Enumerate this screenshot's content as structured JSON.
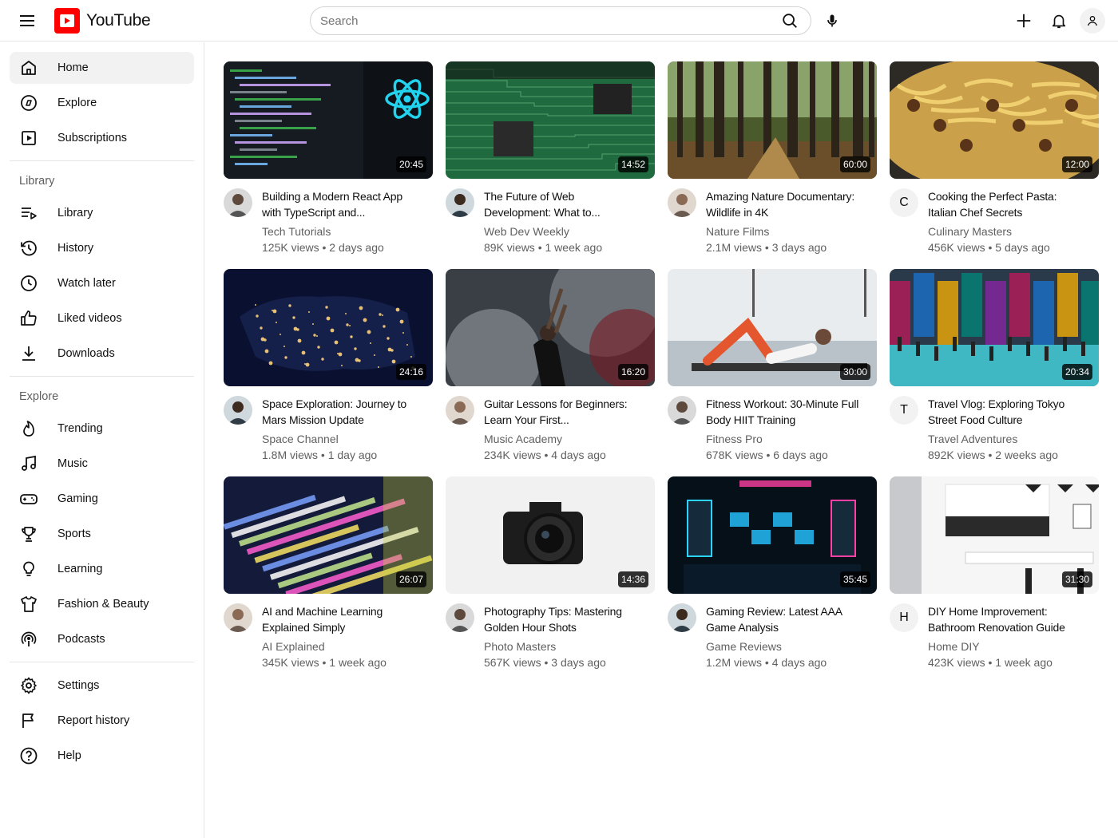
{
  "header": {
    "logo_text": "YouTube",
    "search_placeholder": "Search"
  },
  "sidebar": {
    "main": [
      {
        "label": "Home",
        "icon": "home-icon",
        "active": true
      },
      {
        "label": "Explore",
        "icon": "compass-icon"
      },
      {
        "label": "Subscriptions",
        "icon": "subscriptions-icon"
      }
    ],
    "library_title": "Library",
    "library": [
      {
        "label": "Library",
        "icon": "library-icon"
      },
      {
        "label": "History",
        "icon": "history-icon"
      },
      {
        "label": "Watch later",
        "icon": "clock-icon"
      },
      {
        "label": "Liked videos",
        "icon": "thumbs-up-icon"
      },
      {
        "label": "Downloads",
        "icon": "download-icon"
      }
    ],
    "explore_title": "Explore",
    "explore": [
      {
        "label": "Trending",
        "icon": "flame-icon"
      },
      {
        "label": "Music",
        "icon": "music-icon"
      },
      {
        "label": "Gaming",
        "icon": "gamepad-icon"
      },
      {
        "label": "Sports",
        "icon": "trophy-icon"
      },
      {
        "label": "Learning",
        "icon": "lightbulb-icon"
      },
      {
        "label": "Fashion & Beauty",
        "icon": "shirt-icon"
      },
      {
        "label": "Podcasts",
        "icon": "podcast-icon"
      }
    ],
    "footer": [
      {
        "label": "Settings",
        "icon": "gear-icon"
      },
      {
        "label": "Report history",
        "icon": "flag-icon"
      },
      {
        "label": "Help",
        "icon": "help-icon"
      }
    ]
  },
  "videos": [
    {
      "title": "Building a Modern React App with TypeScript and...",
      "channel": "Tech Tutorials",
      "views": "125K views",
      "age": "2 days ago",
      "duration": "20:45",
      "avatar": "photo",
      "thumb": "code-screen"
    },
    {
      "title": "The Future of Web Development: What to...",
      "channel": "Web Dev Weekly",
      "views": "89K views",
      "age": "1 week ago",
      "duration": "14:52",
      "avatar": "photo",
      "thumb": "circuit-board"
    },
    {
      "title": "Amazing Nature Documentary: Wildlife in 4K",
      "channel": "Nature Films",
      "views": "2.1M views",
      "age": "3 days ago",
      "duration": "60:00",
      "avatar": "photo",
      "thumb": "forest"
    },
    {
      "title": "Cooking the Perfect Pasta: Italian Chef Secrets",
      "channel": "Culinary Masters",
      "views": "456K views",
      "age": "5 days ago",
      "duration": "12:00",
      "avatar": "C",
      "thumb": "pasta"
    },
    {
      "title": "Space Exploration: Journey to Mars Mission Update",
      "channel": "Space Channel",
      "views": "1.8M views",
      "age": "1 day ago",
      "duration": "24:16",
      "avatar": "photo",
      "thumb": "night-map"
    },
    {
      "title": "Guitar Lessons for Beginners: Learn Your First...",
      "channel": "Music Academy",
      "views": "234K views",
      "age": "4 days ago",
      "duration": "16:20",
      "avatar": "photo",
      "thumb": "concert"
    },
    {
      "title": "Fitness Workout: 30-Minute Full Body HIIT Training",
      "channel": "Fitness Pro",
      "views": "678K views",
      "age": "6 days ago",
      "duration": "30:00",
      "avatar": "photo",
      "thumb": "fitness"
    },
    {
      "title": "Travel Vlog: Exploring Tokyo Street Food Culture",
      "channel": "Travel Adventures",
      "views": "892K views",
      "age": "2 weeks ago",
      "duration": "20:34",
      "avatar": "T",
      "thumb": "tokyo"
    },
    {
      "title": "AI and Machine Learning Explained Simply",
      "channel": "AI Explained",
      "views": "345K views",
      "age": "1 week ago",
      "duration": "26:07",
      "avatar": "photo",
      "thumb": "code-colorful"
    },
    {
      "title": "Photography Tips: Mastering Golden Hour Shots",
      "channel": "Photo Masters",
      "views": "567K views",
      "age": "3 days ago",
      "duration": "14:36",
      "avatar": "photo",
      "thumb": "camera"
    },
    {
      "title": "Gaming Review: Latest AAA Game Analysis",
      "channel": "Game Reviews",
      "views": "1.2M views",
      "age": "4 days ago",
      "duration": "35:45",
      "avatar": "photo",
      "thumb": "gaming-room"
    },
    {
      "title": "DIY Home Improvement: Bathroom Renovation Guide",
      "channel": "Home DIY",
      "views": "423K views",
      "age": "1 week ago",
      "duration": "31:30",
      "avatar": "H",
      "thumb": "kitchen"
    }
  ]
}
